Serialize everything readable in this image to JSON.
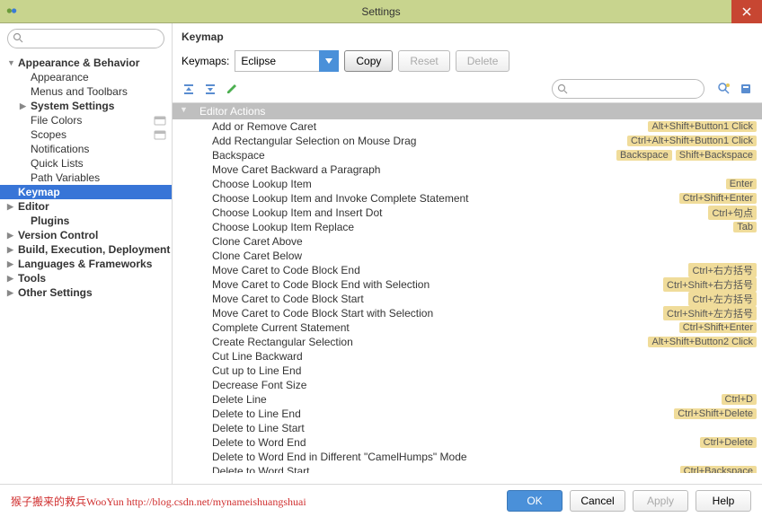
{
  "window": {
    "title": "Settings"
  },
  "sidebar": {
    "items": [
      {
        "label": "Appearance & Behavior",
        "bold": true,
        "indent": 0,
        "arrow": "▼"
      },
      {
        "label": "Appearance",
        "indent": 1
      },
      {
        "label": "Menus and Toolbars",
        "indent": 1
      },
      {
        "label": "System Settings",
        "bold": true,
        "indent": 1,
        "arrow": "▶"
      },
      {
        "label": "File Colors",
        "indent": 1,
        "badge": true
      },
      {
        "label": "Scopes",
        "indent": 1,
        "badge": true
      },
      {
        "label": "Notifications",
        "indent": 1
      },
      {
        "label": "Quick Lists",
        "indent": 1
      },
      {
        "label": "Path Variables",
        "indent": 1
      },
      {
        "label": "Keymap",
        "bold": true,
        "indent": 0,
        "selected": true
      },
      {
        "label": "Editor",
        "bold": true,
        "indent": 0,
        "arrow": "▶"
      },
      {
        "label": "Plugins",
        "bold": true,
        "indent": 1
      },
      {
        "label": "Version Control",
        "bold": true,
        "indent": 0,
        "arrow": "▶"
      },
      {
        "label": "Build, Execution, Deployment",
        "bold": true,
        "indent": 0,
        "arrow": "▶"
      },
      {
        "label": "Languages & Frameworks",
        "bold": true,
        "indent": 0,
        "arrow": "▶"
      },
      {
        "label": "Tools",
        "bold": true,
        "indent": 0,
        "arrow": "▶"
      },
      {
        "label": "Other Settings",
        "bold": true,
        "indent": 0,
        "arrow": "▶"
      }
    ]
  },
  "panel": {
    "title": "Keymap",
    "keymaps_label": "Keymaps:",
    "keymap_selected": "Eclipse",
    "copy_label": "Copy",
    "reset_label": "Reset",
    "delete_label": "Delete",
    "header": "Editor Actions"
  },
  "actions": [
    {
      "name": "Add or Remove Caret",
      "shortcuts": [
        "Alt+Shift+Button1 Click"
      ]
    },
    {
      "name": "Add Rectangular Selection on Mouse Drag",
      "shortcuts": [
        "Ctrl+Alt+Shift+Button1 Click"
      ]
    },
    {
      "name": "Backspace",
      "shortcuts": [
        "Backspace",
        "Shift+Backspace"
      ]
    },
    {
      "name": "Move Caret Backward a Paragraph",
      "shortcuts": []
    },
    {
      "name": "Choose Lookup Item",
      "shortcuts": [
        "Enter"
      ]
    },
    {
      "name": "Choose Lookup Item and Invoke Complete Statement",
      "shortcuts": [
        "Ctrl+Shift+Enter"
      ]
    },
    {
      "name": "Choose Lookup Item and Insert Dot",
      "shortcuts": [
        "Ctrl+句点"
      ]
    },
    {
      "name": "Choose Lookup Item Replace",
      "shortcuts": [
        "Tab"
      ]
    },
    {
      "name": "Clone Caret Above",
      "shortcuts": []
    },
    {
      "name": "Clone Caret Below",
      "shortcuts": []
    },
    {
      "name": "Move Caret to Code Block End",
      "shortcuts": [
        "Ctrl+右方括号"
      ]
    },
    {
      "name": "Move Caret to Code Block End with Selection",
      "shortcuts": [
        "Ctrl+Shift+右方括号"
      ]
    },
    {
      "name": "Move Caret to Code Block Start",
      "shortcuts": [
        "Ctrl+左方括号"
      ]
    },
    {
      "name": "Move Caret to Code Block Start with Selection",
      "shortcuts": [
        "Ctrl+Shift+左方括号"
      ]
    },
    {
      "name": "Complete Current Statement",
      "shortcuts": [
        "Ctrl+Shift+Enter"
      ]
    },
    {
      "name": "Create Rectangular Selection",
      "shortcuts": [
        "Alt+Shift+Button2 Click"
      ]
    },
    {
      "name": "Cut Line Backward",
      "shortcuts": []
    },
    {
      "name": "Cut up to Line End",
      "shortcuts": []
    },
    {
      "name": "Decrease Font Size",
      "shortcuts": []
    },
    {
      "name": "Delete Line",
      "shortcuts": [
        "Ctrl+D"
      ]
    },
    {
      "name": "Delete to Line End",
      "shortcuts": [
        "Ctrl+Shift+Delete"
      ]
    },
    {
      "name": "Delete to Line Start",
      "shortcuts": []
    },
    {
      "name": "Delete to Word End",
      "shortcuts": [
        "Ctrl+Delete"
      ]
    },
    {
      "name": "Delete to Word End in Different \"CamelHumps\" Mode",
      "shortcuts": []
    },
    {
      "name": "Delete to Word Start",
      "shortcuts": [
        "Ctrl+Backspace"
      ]
    }
  ],
  "footer": {
    "watermark": "猴子搬来的救兵WooYun http://blog.csdn.net/mynameishuangshuai",
    "ok": "OK",
    "cancel": "Cancel",
    "apply": "Apply",
    "help": "Help"
  }
}
